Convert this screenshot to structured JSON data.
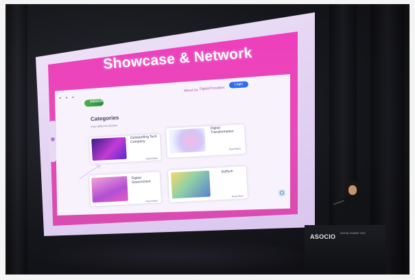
{
  "slide": {
    "title": "Showcase & Network",
    "logo": "ASOCIO",
    "nav_about": "About Us",
    "nav_tech_providers": "Digital Providers",
    "login_label": "Login",
    "categories_heading": "Categories",
    "categories_sub": "View different solution",
    "cards": [
      {
        "title": "Outstanding Tech Company",
        "link": "Read More"
      },
      {
        "title": "Digital Transformation",
        "link": "Read More"
      },
      {
        "title": "Digital Government",
        "link": "Read More"
      },
      {
        "title": "EdTech",
        "link": "Read More"
      }
    ]
  },
  "podium": {
    "brand": "ASOCIO",
    "sub": "DIGITAL SUMMIT 2022"
  },
  "colors": {
    "panel_pink": "#e84ab7",
    "login_blue": "#2f6fe6",
    "logo_green": "#4bb24c",
    "card_title": "#3d3360"
  }
}
